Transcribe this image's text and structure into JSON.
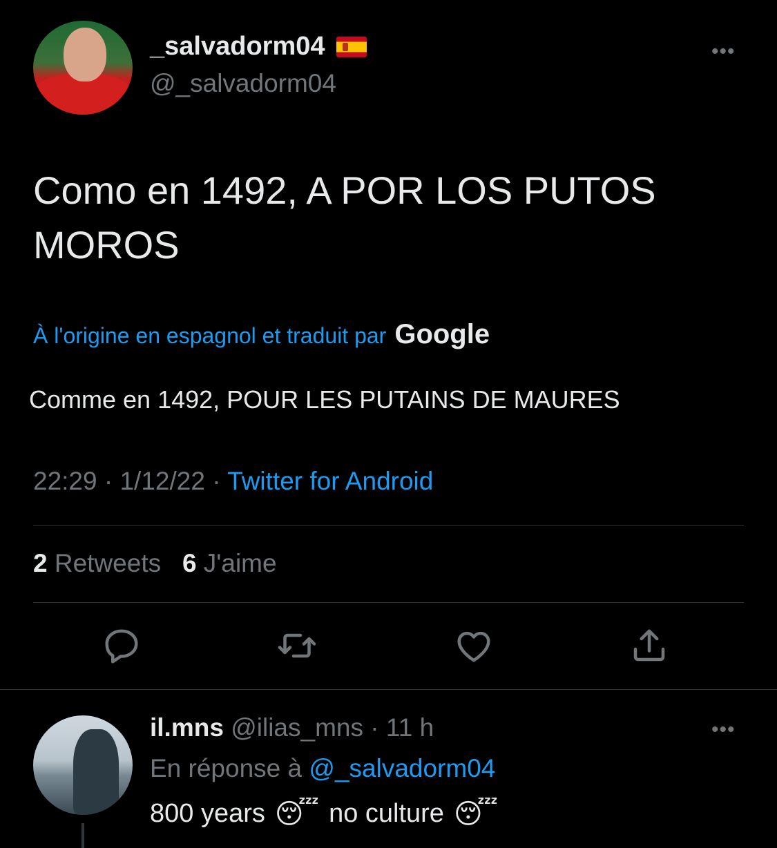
{
  "tweet": {
    "display_name": "_salvadorm04",
    "flag_icon": "spain-flag-icon",
    "handle": "@_salvadorm04",
    "more_icon": "•••",
    "text_line1": "Como en 1492, A POR LOS PUTOS",
    "text_line2": "MOROS",
    "translation_label": "À l'origine en espagnol et traduit par",
    "translation_brand": "Google",
    "translated_text": "Comme en 1492, POUR LES PUTAINS DE MAURES",
    "time": "22:29",
    "sep1": " · ",
    "date": "1/12/22",
    "sep2": " · ",
    "source": "Twitter for Android",
    "retweets_count": "2",
    "retweets_label": "Retweets",
    "likes_count": "6",
    "likes_label": "J'aime"
  },
  "actions": [
    "reply-icon",
    "retweet-icon",
    "like-icon",
    "share-icon"
  ],
  "reply": {
    "name": "il.mns",
    "handle": "@ilias_mns",
    "sep": " · ",
    "time": "11 h",
    "more_icon": "•••",
    "reply_prefix": "En réponse à",
    "reply_mention": "@_salvadorm04",
    "text_part1": "800 years",
    "emoji1": "😴",
    "text_part2": "no culture",
    "emoji2": "😴"
  },
  "colors": {
    "background": "#000000",
    "text": "#e7e9ea",
    "secondary": "#71767b",
    "accent": "#1d9bf0",
    "divider": "#2f3336"
  }
}
